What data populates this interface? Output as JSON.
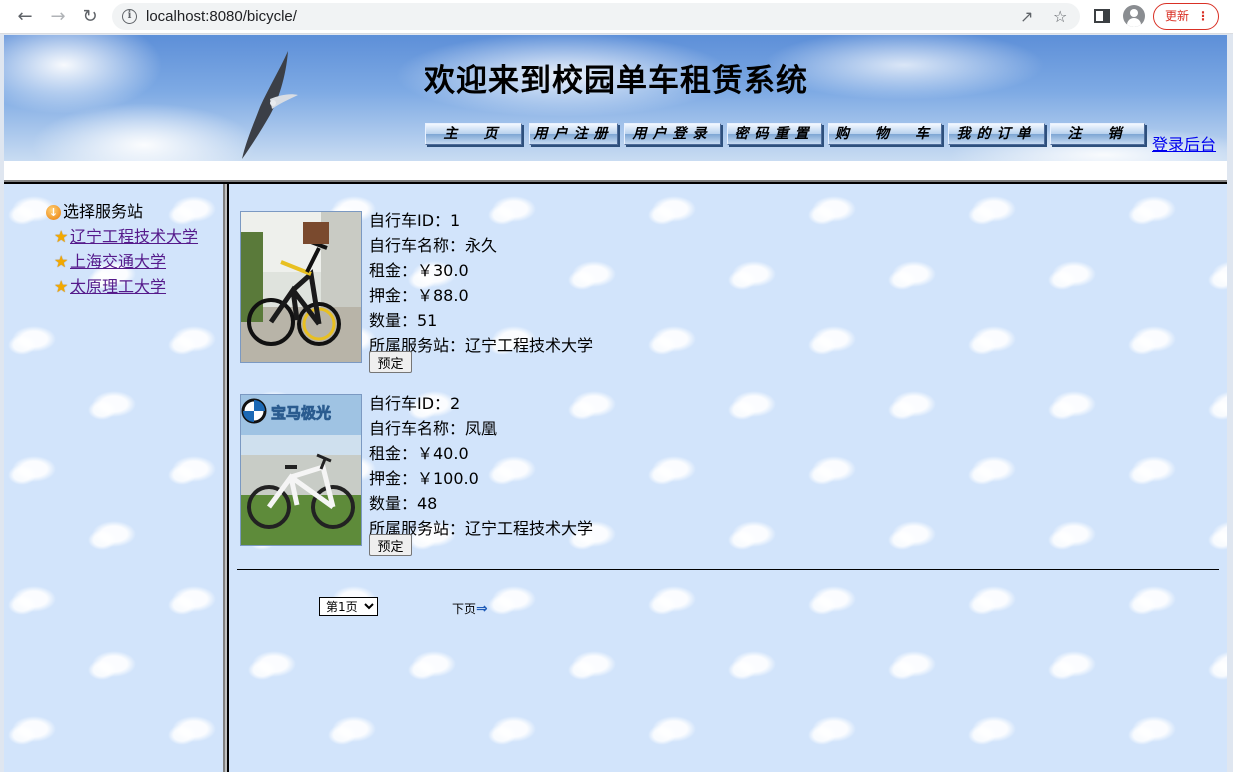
{
  "browser": {
    "url": "localhost:8080/bicycle/",
    "update_label": "更新"
  },
  "header": {
    "title": "欢迎来到校园单车租赁系统",
    "menu": [
      "主　页",
      "用户注册",
      "用户登录",
      "密码重置",
      "购　物　车",
      "我的订单",
      "注　销"
    ],
    "admin_link": "登录后台"
  },
  "sidebar": {
    "title": "选择服务站",
    "items": [
      "辽宁工程技术大学",
      "上海交通大学",
      "太原理工大学"
    ]
  },
  "bikes": [
    {
      "id_line": "自行车ID：1",
      "name_line": "自行车名称：永久",
      "rent_line": "租金：￥30.0",
      "deposit_line": "押金：￥88.0",
      "qty_line": "数量：51",
      "station_line": "所属服务站：辽宁工程技术大学",
      "button": "预定"
    },
    {
      "id_line": "自行车ID：2",
      "name_line": "自行车名称：凤凰",
      "rent_line": "租金：￥40.0",
      "deposit_line": "押金：￥100.0",
      "qty_line": "数量：48",
      "station_line": "所属服务站：辽宁工程技术大学",
      "button": "预定"
    }
  ],
  "pagination": {
    "selected": "第1页",
    "next": "下页"
  },
  "colors": {
    "link": "#0000ee",
    "visited_link": "#551a8b",
    "content_bg": "#d2e4fb"
  },
  "icons": {
    "sidebar_title": "circle-down-icon",
    "sidebar_item": "star-icon",
    "next": "arrow-right-icon"
  },
  "bike2_logo_text": "宝马极光"
}
